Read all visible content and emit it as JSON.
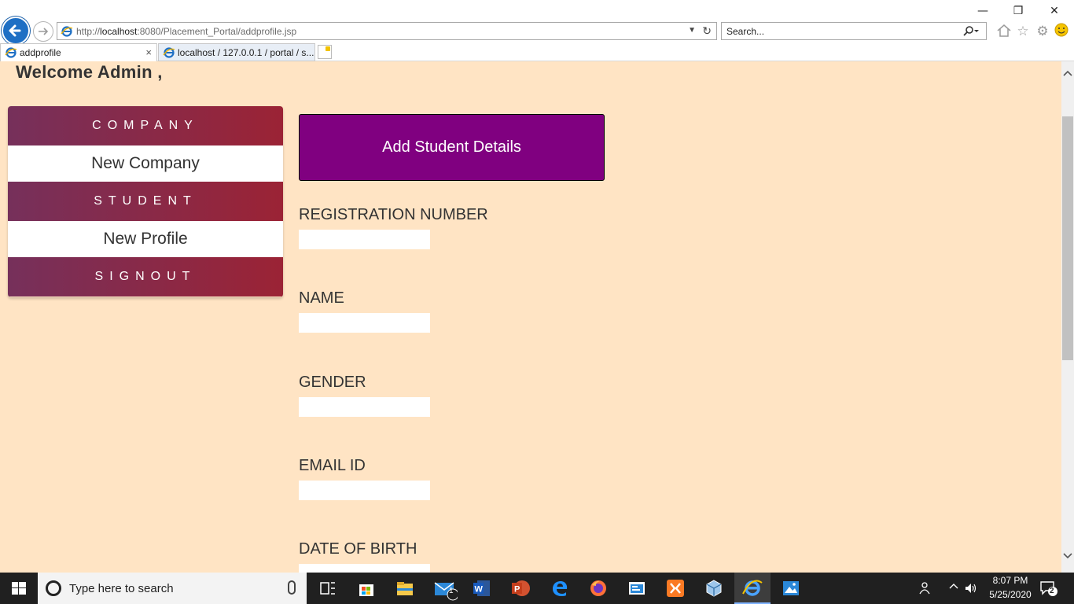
{
  "browser": {
    "url_prefix": "http://",
    "url_host": "localhost",
    "url_rest": ":8080/Placement_Portal/addprofile.jsp",
    "search_placeholder": "Search...",
    "tabs": [
      {
        "label": "addprofile",
        "close": "×"
      },
      {
        "label": "localhost / 127.0.0.1 / portal / s..."
      }
    ],
    "window_controls": {
      "minimize": "—",
      "restore": "❐",
      "close": "✕"
    }
  },
  "page": {
    "welcome": "Welcome Admin ,",
    "sidebar": {
      "sections": [
        {
          "heading": "COMPANY",
          "item": "New Company"
        },
        {
          "heading": "STUDENT",
          "item": "New Profile"
        },
        {
          "heading": "SIGNOUT"
        }
      ]
    },
    "form": {
      "title": "Add Student Details",
      "fields": [
        {
          "label": "REGISTRATION NUMBER",
          "value": ""
        },
        {
          "label": "NAME",
          "value": ""
        },
        {
          "label": "GENDER",
          "value": ""
        },
        {
          "label": "EMAIL ID",
          "value": ""
        },
        {
          "label": "DATE OF BIRTH",
          "value": ""
        }
      ]
    }
  },
  "taskbar": {
    "search_text": "Type here to search",
    "mail_badge": "1",
    "time": "8:07 PM",
    "date": "5/25/2020",
    "notification_count": "2"
  },
  "colors": {
    "page_bg": "#ffe4c4",
    "menu_gradient_start": "#76305b",
    "menu_gradient_end": "#9b2335",
    "form_header_bg": "#800080",
    "browser_accent": "#1e6fc4"
  }
}
